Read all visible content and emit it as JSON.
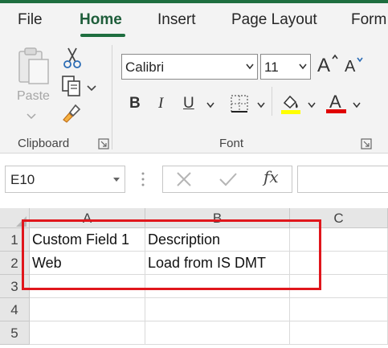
{
  "ribbon": {
    "tabs": [
      {
        "label": "File",
        "active": false
      },
      {
        "label": "Home",
        "active": true
      },
      {
        "label": "Insert",
        "active": false
      },
      {
        "label": "Page Layout",
        "active": false
      },
      {
        "label": "Form",
        "active": false
      }
    ],
    "clipboard": {
      "group_label": "Clipboard",
      "paste_label": "Paste"
    },
    "font": {
      "group_label": "Font",
      "font_name": "Calibri",
      "font_size": "11",
      "bold": "B",
      "italic": "I",
      "underline": "U",
      "font_color_glyph": "A",
      "highlight_color": "#ffff00",
      "font_color": "#e00000"
    }
  },
  "formula_bar": {
    "name_box": "E10",
    "fx": "fx",
    "formula": ""
  },
  "sheet": {
    "columns": [
      "A",
      "B",
      "C"
    ],
    "rows": [
      "1",
      "2",
      "3",
      "4",
      "5"
    ],
    "cells": [
      [
        "Custom Field 1",
        "Description",
        ""
      ],
      [
        "Web",
        "Load from IS DMT",
        ""
      ],
      [
        "",
        "",
        ""
      ],
      [
        "",
        "",
        ""
      ],
      [
        "",
        "",
        ""
      ]
    ]
  },
  "colors": {
    "accent": "#1e6e3f",
    "annotation": "#e0161c"
  }
}
